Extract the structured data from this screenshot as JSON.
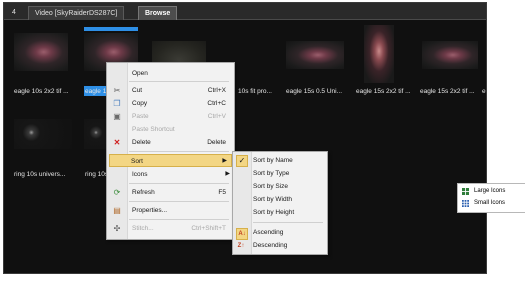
{
  "tabs": {
    "number": "4",
    "video": "Video [SkyRaiderDS287C]",
    "browse": "Browse"
  },
  "row1_captions": [
    "eagle 10s 2x2 tif ...",
    "eagle 10",
    "10s fit pro...",
    "eagle 15s 0.5 Uni...",
    "eagle 15s 2x2 tif ...",
    "eagle 15s 2x2 tif ...",
    "e"
  ],
  "row2_captions": [
    "ring 10s univers...",
    "ring 10s"
  ],
  "context_menu": {
    "open": "Open",
    "cut": "Cut",
    "cut_shortcut": "Ctrl+X",
    "copy": "Copy",
    "copy_shortcut": "Ctrl+C",
    "paste": "Paste",
    "paste_shortcut": "Ctrl+V",
    "paste_shortcut_item": "Paste Shortcut",
    "delete": "Delete",
    "delete_shortcut": "Delete",
    "sort": "Sort",
    "icons": "Icons",
    "refresh": "Refresh",
    "refresh_shortcut": "F5",
    "properties": "Properties...",
    "stitch": "Stitch...",
    "stitch_shortcut": "Ctrl+Shift+T"
  },
  "sort_menu": {
    "by_name": "Sort by Name",
    "by_type": "Sort by Type",
    "by_size": "Sort by Size",
    "by_width": "Sort by Width",
    "by_height": "Sort by Height",
    "ascending": "Ascending",
    "descending": "Descending"
  },
  "icons_menu": {
    "large": "Large Icons",
    "small": "Small Icons"
  },
  "colors": {
    "highlight": "#f3d684",
    "selection": "#2e8fe6"
  }
}
